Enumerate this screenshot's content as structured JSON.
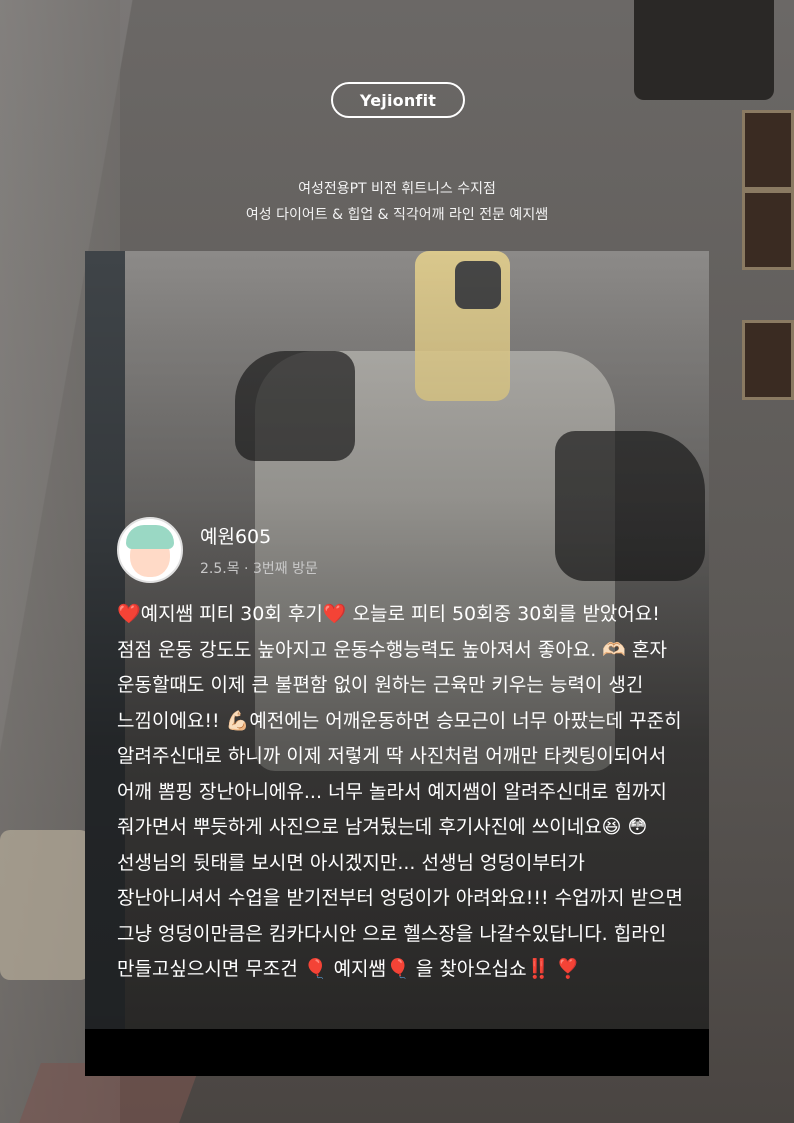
{
  "header": {
    "logo_text": "Yejionfit",
    "tagline_1": "여성전용PT 비전 휘트니스 수지점",
    "tagline_2": "여성 다이어트 & 힙업 & 직각어깨 라인 전문 예지쌤"
  },
  "review": {
    "avatar": "avatar-illustration",
    "username": "예원605",
    "meta": "2.5.목 · 3번째 방문",
    "text": "❤️예지쌤 피티 30회 후기❤️ 오늘로 피티 50회중 30회를 받았어요! 점점 운동 강도도 높아지고 운동수행능력도 높아져서 좋아요. 🫶🏻 혼자 운동할때도 이제 큰 불편함 없이 원하는 근육만 키우는 능력이 생긴 느낌이에요!! 💪🏻예전에는 어깨운동하면 승모근이 너무 아팠는데 꾸준히 알려주신대로 하니까 이제 저렇게 딱 사진처럼 어깨만 타켓팅이되어서 어깨 뽐핑 장난아니에유... 너무 놀라서 예지쌤이 알려주신대로 힘까지 줘가면서 뿌듯하게 사진으로 남겨뒀는데 후기사진에 쓰이네요😆 😳 선생님의 뒷태를 보시면 아시겠지만... 선생님 엉덩이부터가 장난아니셔서 수업을 받기전부터 엉덩이가 아려와요!!! 수업까지 받으면 그냥 엉덩이만큼은 킴카다시안 으로 헬스장을 나갈수있답니다. 힙라인 만들고싶으시면 무조건 🎈 예지쌤🎈 을 찾아오십쇼‼️ ❣️"
  },
  "colors": {
    "text": "#ffffff",
    "meta": "#c8c8c8",
    "bar": "#000000"
  }
}
